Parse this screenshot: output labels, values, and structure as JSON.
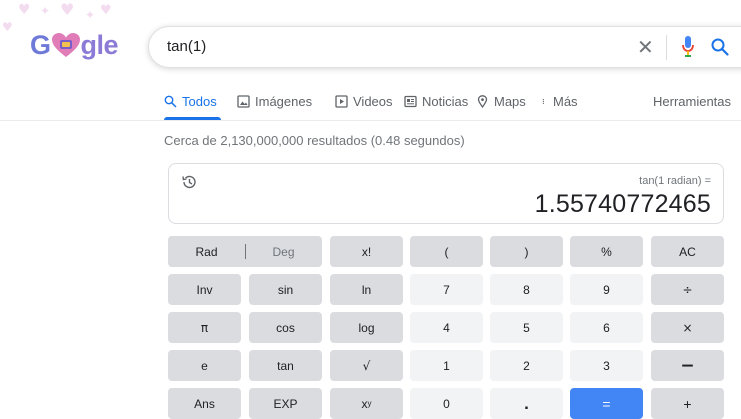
{
  "logo": {
    "text_start": "G",
    "text_end": "gle"
  },
  "search": {
    "query": "tan(1)"
  },
  "tabs": [
    {
      "label": "Todos",
      "icon": "search-icon",
      "active": true
    },
    {
      "label": "Imágenes",
      "icon": "image-icon",
      "active": false
    },
    {
      "label": "Videos",
      "icon": "video-icon",
      "active": false
    },
    {
      "label": "Noticias",
      "icon": "news-icon",
      "active": false
    },
    {
      "label": "Maps",
      "icon": "location-pin-icon",
      "active": false
    },
    {
      "label": "Más",
      "icon": "more-vert-icon",
      "active": false
    }
  ],
  "tools_label": "Herramientas",
  "stats": "Cerca de 2,130,000,000 resultados (0.48 segundos)",
  "calculator": {
    "expression": "tan(1 radian) =",
    "result": "1.55740772465",
    "rad_label": "Rad",
    "deg_label": "Deg",
    "keys": {
      "fact": "x!",
      "lparen": "(",
      "rparen": ")",
      "percent": "%",
      "ac": "AC",
      "inv": "Inv",
      "sin": "sin",
      "ln": "ln",
      "seven": "7",
      "eight": "8",
      "nine": "9",
      "divide": "÷",
      "pi": "π",
      "cos": "cos",
      "log": "log",
      "four": "4",
      "five": "5",
      "six": "6",
      "multiply": "×",
      "e": "e",
      "tan": "tan",
      "sqrt": "√",
      "one": "1",
      "two": "2",
      "three": "3",
      "minus": "−",
      "ans": "Ans",
      "exp": "EXP",
      "pow_base": "x",
      "pow_exp": "y",
      "zero": "0",
      "dot": ".",
      "equals": "=",
      "plus": "+"
    }
  },
  "colors": {
    "accent": "#1a73e8",
    "equals_key": "#4285f4",
    "mic_red": "#ea4335"
  }
}
